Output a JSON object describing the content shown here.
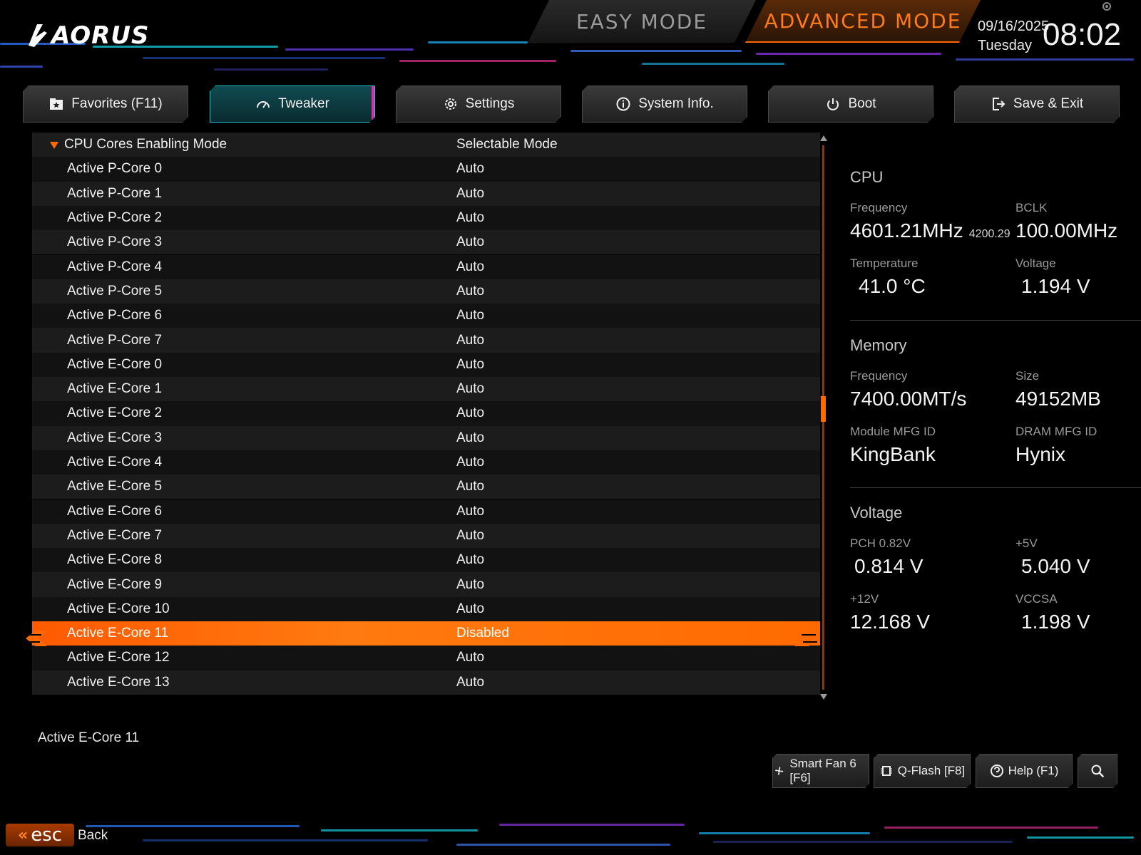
{
  "header": {
    "logo_text": "AORUS",
    "mode_easy": "EASY MODE",
    "mode_advanced": "ADVANCED MODE",
    "date": "09/16/2025",
    "weekday": "Tuesday",
    "time": "08:02"
  },
  "tabs": [
    {
      "label": "Favorites (F11)",
      "icon": "star-folder-icon"
    },
    {
      "label": "Tweaker",
      "icon": "speedometer-icon"
    },
    {
      "label": "Settings",
      "icon": "gear-icon"
    },
    {
      "label": "System Info.",
      "icon": "info-icon"
    },
    {
      "label": "Boot",
      "icon": "power-icon"
    },
    {
      "label": "Save & Exit",
      "icon": "exit-icon"
    }
  ],
  "active_tab": "Tweaker",
  "list": {
    "header": {
      "label": "CPU Cores Enabling Mode",
      "value": "Selectable Mode"
    },
    "rows": [
      {
        "label": "Active P-Core 0",
        "value": "Auto"
      },
      {
        "label": "Active P-Core 1",
        "value": "Auto"
      },
      {
        "label": "Active P-Core 2",
        "value": "Auto"
      },
      {
        "label": "Active P-Core 3",
        "value": "Auto"
      },
      {
        "label": "Active P-Core 4",
        "value": "Auto"
      },
      {
        "label": "Active P-Core 5",
        "value": "Auto"
      },
      {
        "label": "Active P-Core 6",
        "value": "Auto"
      },
      {
        "label": "Active P-Core 7",
        "value": "Auto"
      },
      {
        "label": "Active E-Core 0",
        "value": "Auto"
      },
      {
        "label": "Active E-Core 1",
        "value": "Auto"
      },
      {
        "label": "Active E-Core 2",
        "value": "Auto"
      },
      {
        "label": "Active E-Core 3",
        "value": "Auto"
      },
      {
        "label": "Active E-Core 4",
        "value": "Auto"
      },
      {
        "label": "Active E-Core 5",
        "value": "Auto"
      },
      {
        "label": "Active E-Core 6",
        "value": "Auto"
      },
      {
        "label": "Active E-Core 7",
        "value": "Auto"
      },
      {
        "label": "Active E-Core 8",
        "value": "Auto"
      },
      {
        "label": "Active E-Core 9",
        "value": "Auto"
      },
      {
        "label": "Active E-Core 10",
        "value": "Auto"
      },
      {
        "label": "Active E-Core 11",
        "value": "Disabled"
      },
      {
        "label": "Active E-Core 12",
        "value": "Auto"
      },
      {
        "label": "Active E-Core 13",
        "value": "Auto"
      }
    ],
    "selected_label": "Active E-Core 11"
  },
  "panel": {
    "cpu": {
      "title": "CPU",
      "frequency_label": "Frequency",
      "frequency_value": "4601.21MHz",
      "frequency_sub": "4200.29",
      "bclk_label": "BCLK",
      "bclk_value": "100.00MHz",
      "temp_label": "Temperature",
      "temp_value": "41.0 °C",
      "voltage_label": "Voltage",
      "voltage_value": "1.194 V"
    },
    "memory": {
      "title": "Memory",
      "frequency_label": "Frequency",
      "frequency_value": "7400.00MT/s",
      "size_label": "Size",
      "size_value": "49152MB",
      "module_label": "Module MFG ID",
      "module_value": "KingBank",
      "dram_label": "DRAM MFG ID",
      "dram_value": "Hynix"
    },
    "voltage": {
      "title": "Voltage",
      "pch_label": "PCH 0.82V",
      "pch_value": "0.814 V",
      "v5_label": "+5V",
      "v5_value": "5.040 V",
      "v12_label": "+12V",
      "v12_value": "12.168 V",
      "vccsa_label": "VCCSA",
      "vccsa_value": "1.198 V"
    }
  },
  "footer": {
    "help_text": "Active E-Core 11",
    "buttons": [
      {
        "label": "Smart Fan 6 [F6]",
        "icon": "fan-icon"
      },
      {
        "label": "Q-Flash [F8]",
        "icon": "chip-icon"
      },
      {
        "label": "Help (F1)",
        "icon": "help-icon"
      }
    ],
    "esc_key": "esc",
    "back_label": "Back"
  },
  "colors": {
    "accent": "#ff6a00",
    "tab_active_border": "#20c6d0",
    "tab_active_edge": "#e02aa0"
  }
}
